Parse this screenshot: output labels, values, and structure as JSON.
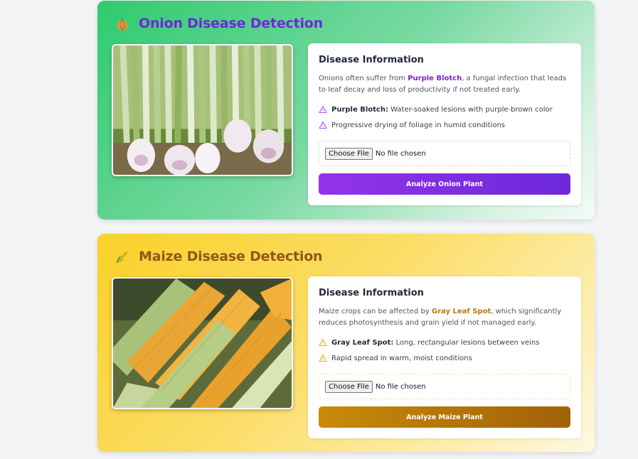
{
  "cards": {
    "onion": {
      "title": "Onion Disease Detection",
      "icon": "onion-icon",
      "image_icon": "onion-photo",
      "info_heading": "Disease Information",
      "desc_before": "Onions often suffer from ",
      "desc_highlight": "Purple Blotch",
      "desc_after": ", a fungal infection that leads to leaf decay and loss of productivity if not treated early.",
      "point1_label": "Purple Blotch:",
      "point1_text": " Water-soaked lesions with purple-brown color",
      "point2_text": "Progressive drying of foliage in humid conditions",
      "choose_label": "Choose File",
      "no_file_text": "No file chosen",
      "analyze_label": "Analyze Onion Plant",
      "accent_color": "#7e22ce"
    },
    "maize": {
      "title": "Maize Disease Detection",
      "icon": "corn-icon",
      "image_icon": "maize-photo",
      "info_heading": "Disease Information",
      "desc_before": "Maize crops can be affected by ",
      "desc_highlight": "Gray Leaf Spot",
      "desc_after": ", which significantly reduces photosynthesis and grain yield if not managed early.",
      "point1_label": "Gray Leaf Spot:",
      "point1_text": " Long, rectangular lesions between veins",
      "point2_text": "Rapid spread in warm, moist conditions",
      "choose_label": "Choose File",
      "no_file_text": "No file chosen",
      "analyze_label": "Analyze Maize Plant",
      "accent_color": "#b7790a"
    }
  }
}
